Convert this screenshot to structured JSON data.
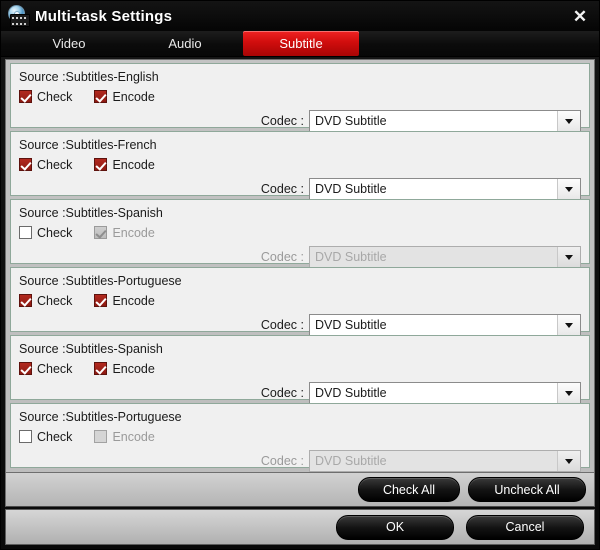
{
  "window": {
    "title": "Multi-task Settings",
    "close_label": "✕",
    "app_icon": "disc-film-icon"
  },
  "tabs": [
    {
      "label": "Video",
      "active": false
    },
    {
      "label": "Audio",
      "active": false
    },
    {
      "label": "Subtitle",
      "active": true
    }
  ],
  "labels": {
    "check": "Check",
    "encode": "Encode",
    "codec": "Codec :"
  },
  "sections": [
    {
      "source": "Source :Subtitles-English",
      "check": true,
      "encode": true,
      "enabled": true,
      "codec": "DVD Subtitle"
    },
    {
      "source": "Source :Subtitles-French",
      "check": true,
      "encode": true,
      "enabled": true,
      "codec": "DVD Subtitle"
    },
    {
      "source": "Source :Subtitles-Spanish",
      "check": false,
      "encode": true,
      "enabled": false,
      "codec": "DVD Subtitle"
    },
    {
      "source": "Source :Subtitles-Portuguese",
      "check": true,
      "encode": true,
      "enabled": true,
      "codec": "DVD Subtitle"
    },
    {
      "source": "Source :Subtitles-Spanish",
      "check": true,
      "encode": true,
      "enabled": true,
      "codec": "DVD Subtitle"
    },
    {
      "source": "Source :Subtitles-Portuguese",
      "check": false,
      "encode": false,
      "enabled": false,
      "codec": "DVD Subtitle"
    }
  ],
  "actions": {
    "check_all": "Check All",
    "uncheck_all": "Uncheck All",
    "ok": "OK",
    "cancel": "Cancel"
  },
  "colors": {
    "accent_red": "#d00d0d",
    "checkbox_red": "#8d1a12",
    "section_border": "#8fa89a",
    "panel_bg": "#c3c3c3"
  }
}
